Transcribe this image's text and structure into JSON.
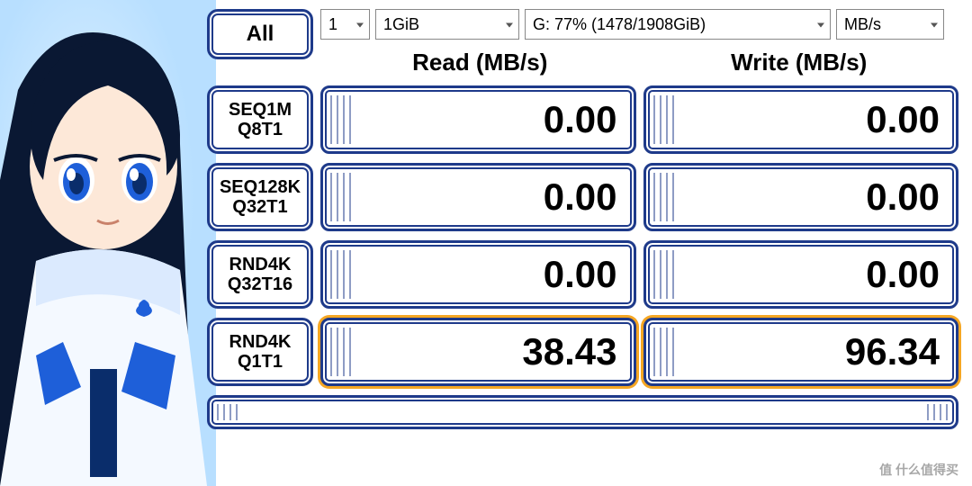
{
  "controls": {
    "all_button": "All",
    "runs": "1",
    "size": "1GiB",
    "drive": "G: 77% (1478/1908GiB)",
    "unit": "MB/s"
  },
  "columns": {
    "read": "Read (MB/s)",
    "write": "Write (MB/s)"
  },
  "tests": [
    {
      "label1": "SEQ1M",
      "label2": "Q8T1",
      "read": "0.00",
      "write": "0.00",
      "active": false
    },
    {
      "label1": "SEQ128K",
      "label2": "Q32T1",
      "read": "0.00",
      "write": "0.00",
      "active": false
    },
    {
      "label1": "RND4K",
      "label2": "Q32T16",
      "read": "0.00",
      "write": "0.00",
      "active": false
    },
    {
      "label1": "RND4K",
      "label2": "Q1T1",
      "read": "38.43",
      "write": "96.34",
      "active": true
    }
  ],
  "watermark": "值 什么值得买"
}
